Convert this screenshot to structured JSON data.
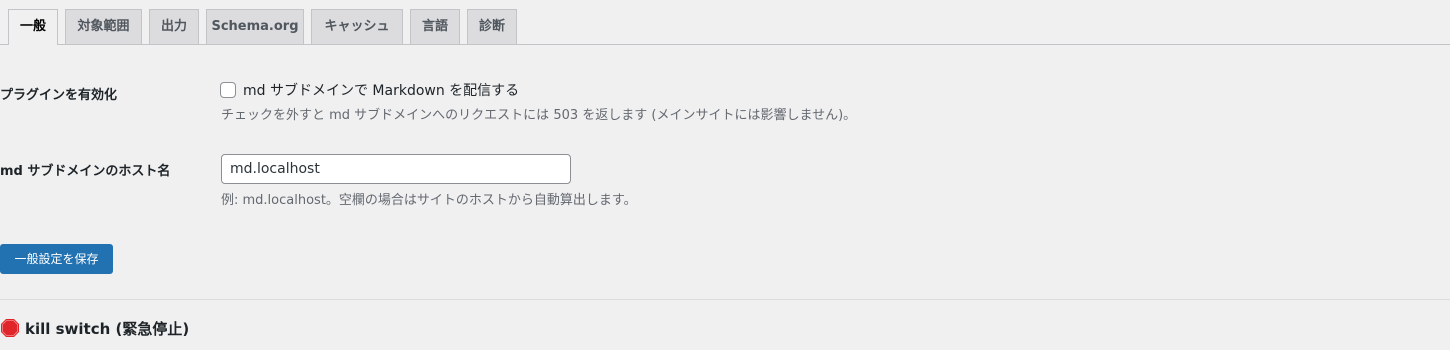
{
  "tabs": [
    {
      "label": "一般",
      "active": true
    },
    {
      "label": "対象範囲",
      "active": false
    },
    {
      "label": "出力",
      "active": false
    },
    {
      "label": "Schema.org",
      "active": false
    },
    {
      "label": "キャッシュ",
      "active": false
    },
    {
      "label": "言語",
      "active": false
    },
    {
      "label": "診断",
      "active": false
    }
  ],
  "enable_plugin": {
    "label": "プラグインを有効化",
    "checkbox_label": "md サブドメインで Markdown を配信する",
    "checked": false,
    "description": "チェックを外すと md サブドメインへのリクエストには 503 を返します (メインサイトには影響しません)。"
  },
  "host": {
    "label": "md サブドメインのホスト名",
    "value": "md.localhost",
    "description": "例: md.localhost。空欄の場合はサイトのホストから自動算出します。"
  },
  "save_button": "一般設定を保存",
  "kill_switch": {
    "icon": "stop-sign-icon",
    "title": "kill switch (緊急停止)"
  },
  "colors": {
    "background": "#f0f0f1",
    "primary_button": "#2271b1",
    "stop_icon": "#e0262a"
  }
}
